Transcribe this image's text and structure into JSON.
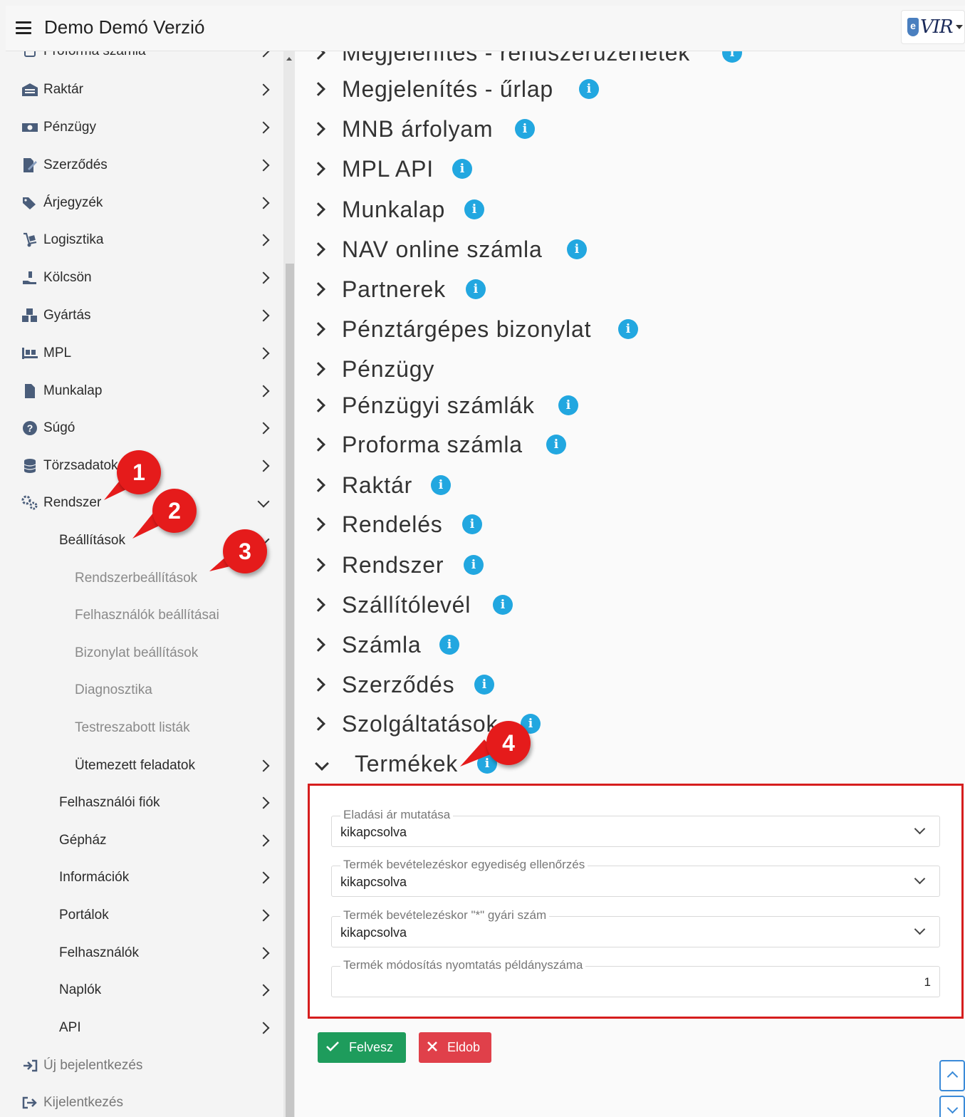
{
  "header": {
    "title": "Demo Demó Verzió",
    "logo_e": "e",
    "logo_text": "VIR"
  },
  "sidebar": {
    "items": [
      {
        "label": "Proforma számla",
        "icon": "document-icon"
      },
      {
        "label": "Raktár",
        "icon": "warehouse-icon"
      },
      {
        "label": "Pénzügy",
        "icon": "money-icon"
      },
      {
        "label": "Szerződés",
        "icon": "contract-icon"
      },
      {
        "label": "Árjegyzék",
        "icon": "tags-icon"
      },
      {
        "label": "Logisztika",
        "icon": "dolly-icon"
      },
      {
        "label": "Kölcsön",
        "icon": "hand-holding-icon"
      },
      {
        "label": "Gyártás",
        "icon": "cubes-icon"
      },
      {
        "label": "MPL",
        "icon": "pallet-icon"
      },
      {
        "label": "Munkalap",
        "icon": "file-icon"
      },
      {
        "label": "Súgó",
        "icon": "question-icon"
      },
      {
        "label": "Törzsadatok",
        "icon": "database-icon"
      },
      {
        "label": "Rendszer",
        "icon": "cogs-icon"
      }
    ],
    "settings": {
      "label": "Beállítások"
    },
    "settings_children": [
      "Rendszerbeállítások",
      "Felhasználók beállításai",
      "Bizonylat beállítások",
      "Diagnosztika",
      "Testreszabott listák",
      "Ütemezett feladatok"
    ],
    "system_children": [
      "Felhasználói fiók",
      "Gépház",
      "Információk",
      "Portálok",
      "Felhasználók",
      "Naplók",
      "API"
    ],
    "footer": [
      {
        "label": "Új bejelentkezés",
        "icon": "sign-in-icon"
      },
      {
        "label": "Kijelentkezés",
        "icon": "sign-out-icon"
      }
    ]
  },
  "accordion": {
    "info_glyph": "i",
    "items": [
      "Megjelenítés - rendszerüzenetek",
      "Megjelenítés - űrlap",
      "MNB árfolyam",
      "MPL API",
      "Munkalap",
      "NAV online számla",
      "Partnerek",
      "Pénztárgépes bizonylat",
      "Pénzügy",
      "Pénzügyi számlák",
      "Proforma számla",
      "Raktár",
      "Rendelés",
      "Rendszer",
      "Szállítólevél",
      "Számla",
      "Szerződés",
      "Szolgáltatások",
      "Termékek"
    ]
  },
  "form": {
    "fields": [
      {
        "label": "Eladási ár mutatása",
        "value": "kikapcsolva"
      },
      {
        "label": "Termék bevételezéskor egyediség ellenőrzés",
        "value": "kikapcsolva"
      },
      {
        "label": "Termék bevételezéskor \"*\" gyári szám",
        "value": "kikapcsolva"
      },
      {
        "label": "Termék módosítás nyomtatás példányszáma",
        "value": "1"
      }
    ],
    "save_label": "Felvesz",
    "cancel_label": "Eldob"
  },
  "callouts": [
    "1",
    "2",
    "3",
    "4"
  ],
  "colors": {
    "info": "#22a7e0",
    "save": "#1e9c5c",
    "cancel": "#e0404a",
    "highlight": "#d61e1e",
    "callout": "#e51b1b"
  }
}
